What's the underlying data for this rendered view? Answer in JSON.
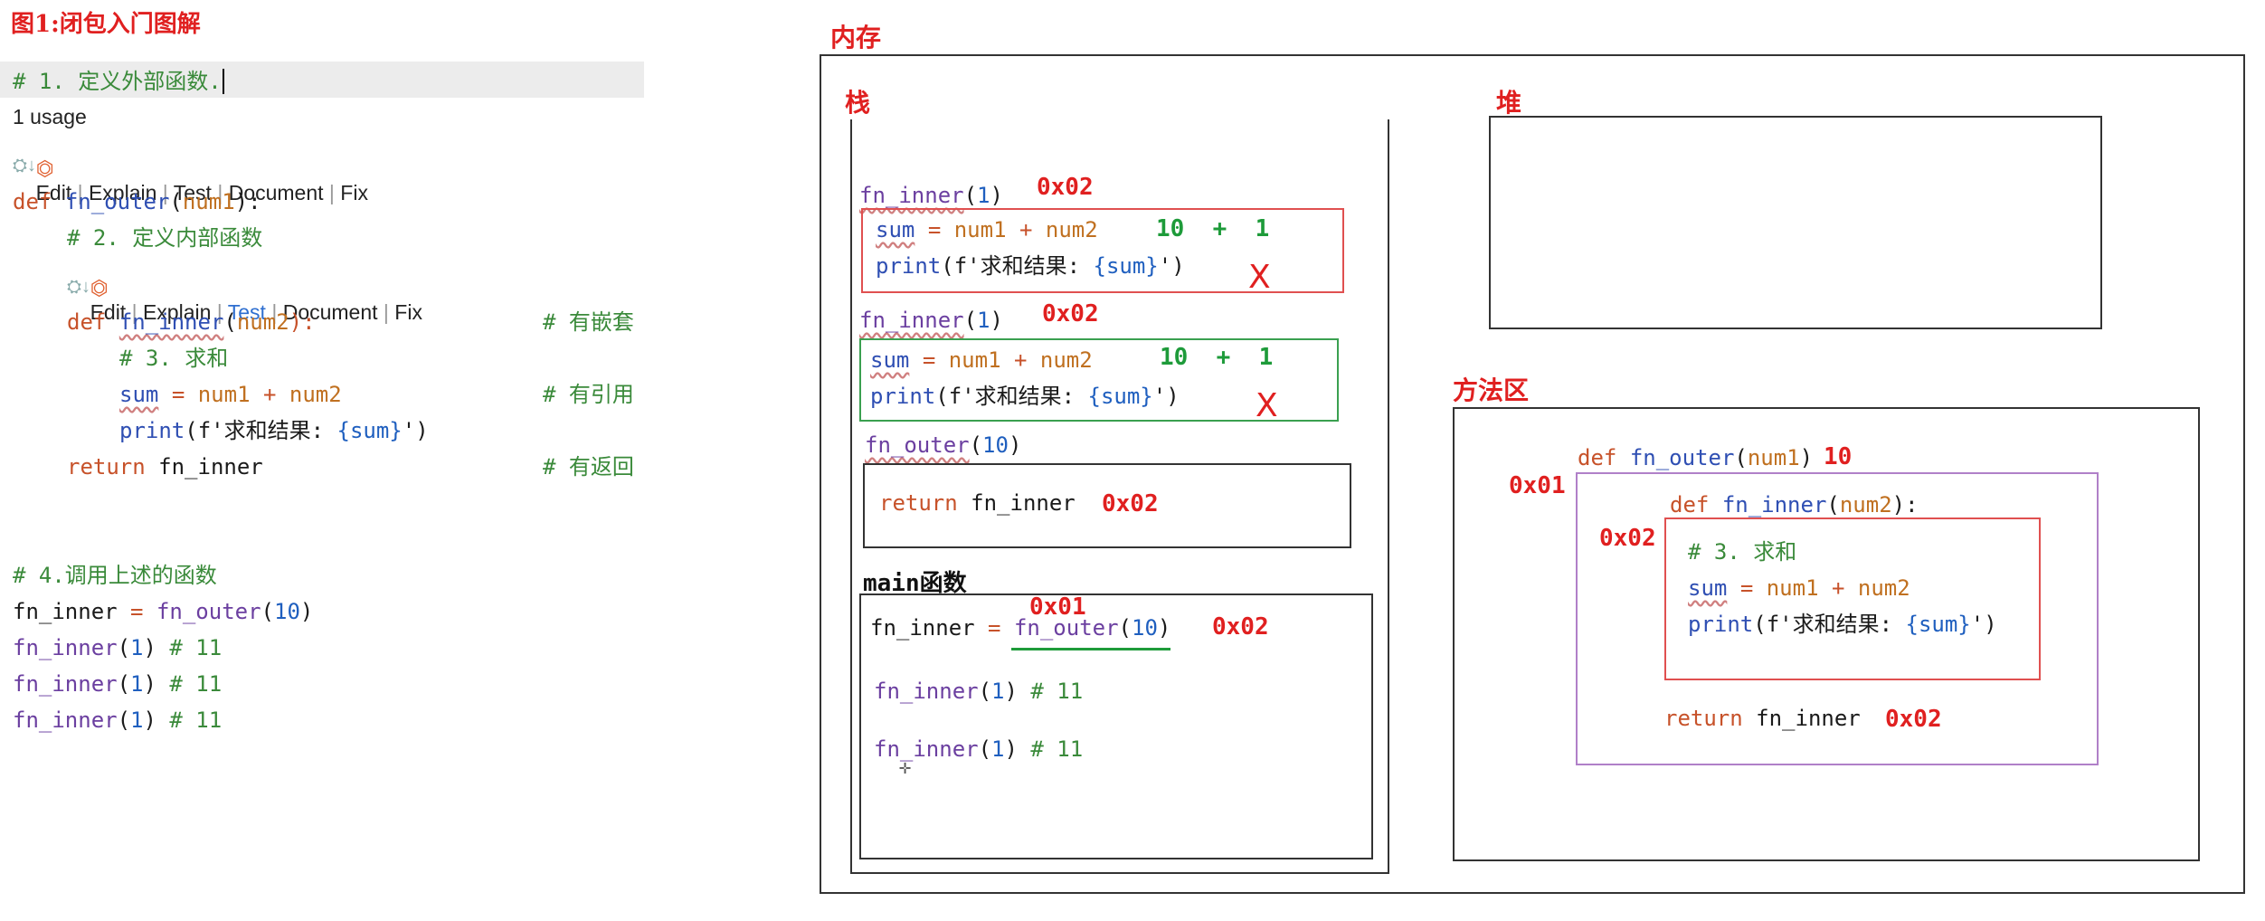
{
  "figure_title": "图1:闭包入门图解",
  "editor": {
    "line_comment1": "# 1. 定义外部函数.",
    "usage": "1 usage",
    "actions": [
      "Edit",
      "Explain",
      "Test",
      "Document",
      "Fix"
    ],
    "def_outer": {
      "kw": "def",
      "name": "fn_outer",
      "param": "num1",
      "tail": "):"
    },
    "comment2": "# 2. 定义内部函数",
    "def_inner": {
      "kw": "def",
      "name": "fn_inner",
      "param": "num2",
      "tail": "):"
    },
    "note_nested": "# 有嵌套",
    "comment3": "# 3. 求和",
    "sum_line": {
      "var": "sum",
      "expr_a": "num1",
      "op": "+",
      "expr_b": "num2"
    },
    "note_ref": "# 有引用",
    "print_line": {
      "fn": "print",
      "pre": "(f'求和结果: ",
      "inner": "{sum}",
      "post": "')"
    },
    "return_line": {
      "kw": "return",
      "val": "fn_inner"
    },
    "note_return": "# 有返回",
    "comment4": "# 4.调用上述的函数",
    "call_assign": {
      "var": "fn_inner",
      "fn": "fn_outer",
      "arg": "10"
    },
    "calls": [
      {
        "fn": "fn_inner",
        "arg": "1",
        "comment": "# 11"
      },
      {
        "fn": "fn_inner",
        "arg": "1",
        "comment": "# 11"
      },
      {
        "fn": "fn_inner",
        "arg": "1",
        "comment": "# 11"
      }
    ]
  },
  "memory": {
    "title": "内存",
    "stack_title": "栈",
    "heap_title": "堆",
    "method_title": "方法区",
    "frame1": {
      "label_fn": "fn_inner",
      "label_arg": "1",
      "addr": "0x02",
      "vals": "10  +  1",
      "x": "X"
    },
    "frame2": {
      "label_fn": "fn_inner",
      "label_arg": "1",
      "addr": "0x02",
      "vals": "10  +  1",
      "x": "X"
    },
    "frame3": {
      "label_fn": "fn_outer",
      "label_arg": "10",
      "ret_kw": "return",
      "ret_val": "fn_inner",
      "addr": "0x02"
    },
    "main": {
      "label": "main函数",
      "addr_top": "0x01",
      "assign_var": "fn_inner",
      "assign_fn": "fn_outer",
      "assign_arg": "10",
      "addr": "0x02",
      "call1": {
        "fn": "fn_inner",
        "arg": "1",
        "comment": "# 11"
      },
      "call2": {
        "fn": "fn_inner",
        "arg": "1",
        "comment": "# 11"
      }
    },
    "method": {
      "addr_outer": "0x01",
      "outer_def": {
        "kw": "def",
        "name": "fn_outer",
        "param": "num1",
        "tail": ")",
        "arg_val": "10"
      },
      "addr_inner": "0x02",
      "inner_def": {
        "kw": "def",
        "name": "fn_inner",
        "param": "num2",
        "tail": "):"
      },
      "comment": "# 3. 求和",
      "ret_kw": "return",
      "ret_val": "fn_inner",
      "ret_addr": "0x02"
    }
  },
  "colors": {
    "accent_red": "#e02020",
    "accent_green": "#1e9b3a",
    "purple_box": "#a070c0"
  }
}
